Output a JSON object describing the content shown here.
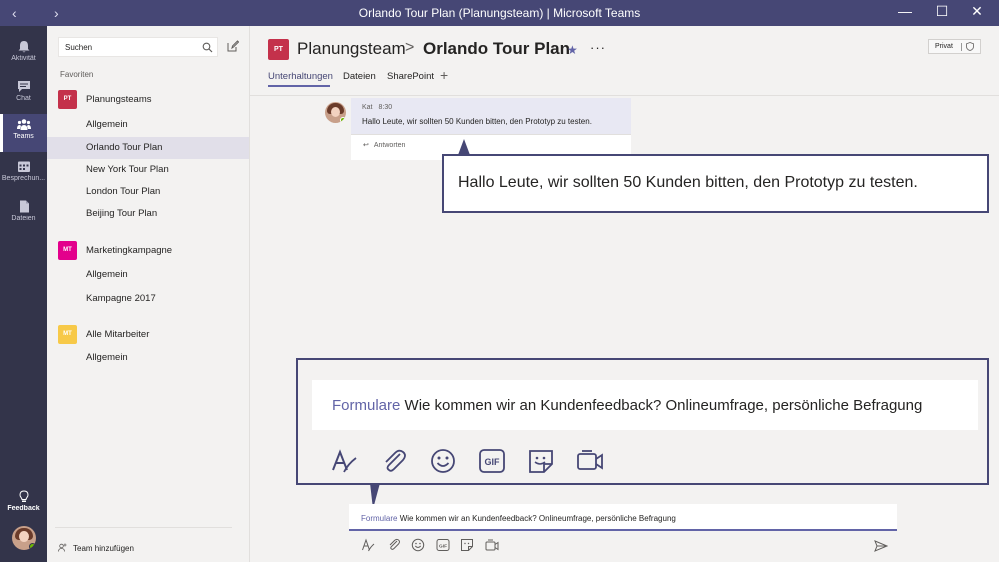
{
  "window": {
    "title": "Orlando Tour Plan (Planungsteam) | Microsoft Teams",
    "back": "‹",
    "forward": "›",
    "minimize": "—",
    "maximize": "☐",
    "close": "✕"
  },
  "rail": {
    "items": [
      {
        "label": "Aktivität",
        "icon": "bell-icon"
      },
      {
        "label": "Chat",
        "icon": "chat-icon"
      },
      {
        "label": "Teams",
        "icon": "teams-icon"
      },
      {
        "label": "Besprechun...",
        "icon": "calendar-icon"
      },
      {
        "label": "Dateien",
        "icon": "file-icon"
      }
    ],
    "feedback_label": "Feedback"
  },
  "sidebar": {
    "search_placeholder": "Suchen",
    "favorites_label": "Favoriten",
    "teams": [
      {
        "initials": "PT",
        "name": "Planungsteams",
        "color": "#c4314b",
        "channels": [
          "Allgemein",
          "Orlando Tour Plan",
          "New York Tour Plan",
          "London Tour Plan",
          "Beijing Tour Plan"
        ]
      },
      {
        "initials": "MT",
        "name": "Marketingkampagne",
        "color": "#e3008c",
        "channels": [
          "Allgemein",
          "Kampagne 2017"
        ]
      },
      {
        "initials": "MT",
        "name": "Alle Mitarbeiter",
        "color": "#f7c948",
        "channels": [
          "Allgemein"
        ]
      }
    ],
    "active_channel": "Orlando Tour Plan",
    "add_team_label": "Team hinzufügen"
  },
  "header": {
    "team_initials": "PT",
    "team_name": "Planungsteam",
    "separator": ">",
    "channel_name": "Orlando Tour Plan",
    "more": "···",
    "privacy": "Privat",
    "tabs": [
      "Unterhaltungen",
      "Dateien",
      "SharePoint"
    ],
    "add_tab": "+"
  },
  "message": {
    "author": "Kat",
    "time": "8:30",
    "text": "Hallo Leute, wir sollten 50 Kunden bitten, den Prototyp zu testen.",
    "reply_label": "Antworten"
  },
  "callout_message": {
    "text": "Hallo Leute, wir sollten 50 Kunden bitten, den Prototyp zu testen."
  },
  "callout_compose": {
    "format_label": "Formulare",
    "text": "Wie kommen wir an Kundenfeedback? Onlineumfrage, persönliche Befragung",
    "icons": [
      "format-icon",
      "attach-icon",
      "emoji-icon",
      "gif-icon",
      "sticker-icon",
      "meet-icon"
    ]
  },
  "compose": {
    "format_label": "Formulare",
    "text": "Wie kommen wir an Kundenfeedback? Onlineumfrage, persönliche Befragung",
    "send_icon": "send-icon"
  },
  "colors": {
    "accent": "#6264a7",
    "titlebar": "#464775",
    "rail": "#33344a"
  }
}
